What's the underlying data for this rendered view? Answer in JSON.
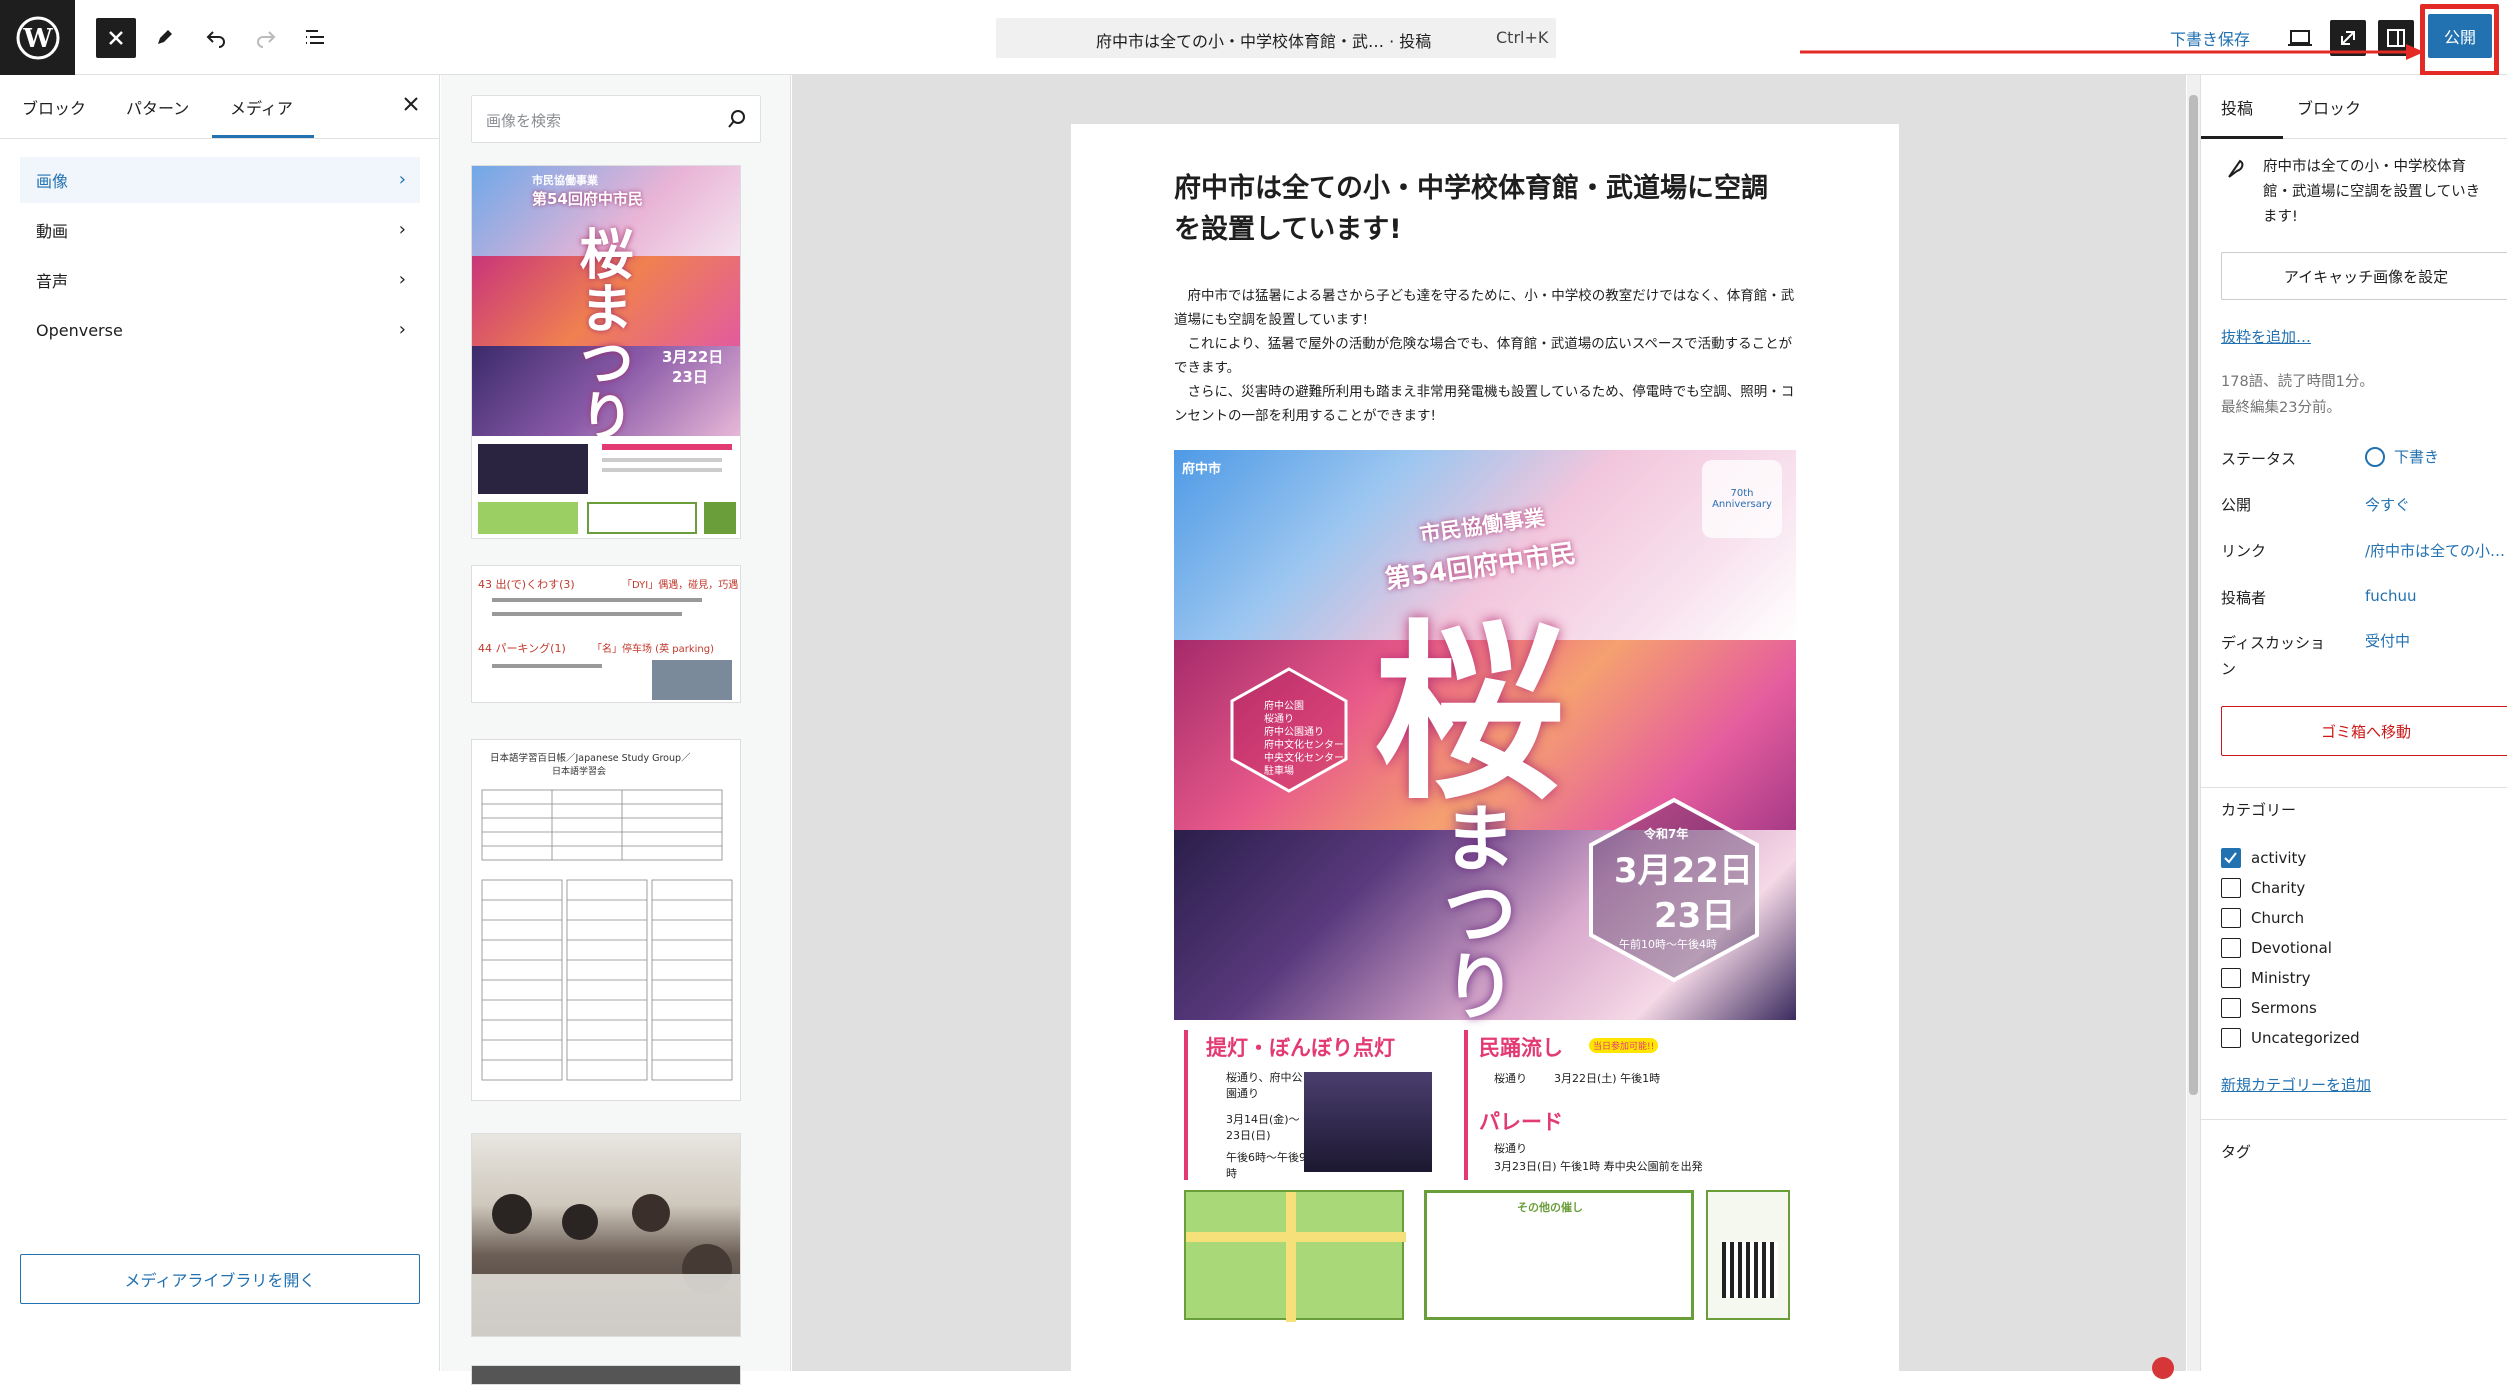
{
  "topbar": {
    "document_title": "府中市は全ての小・中学校体育館・武…  · 投稿",
    "shortcut": "Ctrl+K",
    "save_draft": "下書き保存",
    "publish": "公開"
  },
  "inserter": {
    "tabs": [
      "ブロック",
      "パターン",
      "メディア"
    ],
    "active_tab": "メディア",
    "categories": [
      "画像",
      "動画",
      "音声",
      "Openverse"
    ],
    "selected_category": "画像",
    "open_library": "メディアライブラリを開く"
  },
  "media": {
    "search_placeholder": "画像を検索",
    "poster_thumb": {
      "org": "市民協働事業",
      "event": "第54回府中市民",
      "big": "桜まつり",
      "date1": "3月22日",
      "date2": "23日"
    },
    "map_thumb": {
      "line1": "43 出(で)くわす(3)",
      "line1b": "「DYI」偶遇，碰見，巧遇",
      "line2": "44 パーキング(1)",
      "line2b": "「名」停车场 (英 parking)"
    },
    "schedule_thumb": {
      "title": "日本語学習百日帳／Japanese Study Group／",
      "sub": "日本語学習会"
    }
  },
  "post": {
    "title": "府中市は全ての小・中学校体育館・武道場に空調を設置しています!",
    "paragraphs": [
      "府中市では猛暑による暑さから子ども達を守るために、小・中学校の教室だけではなく、体育館・武道場にも空調を設置しています!",
      "これにより、猛暑で屋外の活動が危険な場合でも、体育館・武道場の広いスペースで活動することができます。",
      "さらに、災害時の避難所利用も踏まえ非常用発電機も設置しているため、停電時でも空調、照明・コンセントの一部を利用することができます!"
    ],
    "poster": {
      "city": "府中市",
      "org": "市民協働事業",
      "event": "第54回府中市民",
      "big1": "桜",
      "big2": "まつり",
      "era": "令和7年",
      "date1": "3月22日",
      "date2": "23日",
      "time": "午前10時〜午後4時",
      "venues": [
        "府中公園",
        "桜通り",
        "府中公園通り",
        "府中文化センター",
        "中央文化センター",
        "駐車場"
      ],
      "ev1_title": "提灯・ぼんぼり点灯",
      "ev1_place": "桜通り、府中公園通り",
      "ev1_date": "3月14日(金)〜23日(日)",
      "ev1_time": "午後6時〜午後9時",
      "ev2_title": "民踊流し",
      "ev2_tag": "当日参加可能!!",
      "ev2_place": "桜通り",
      "ev2_date": "3月22日(土) 午後1時",
      "ev3_title": "パレード",
      "ev3_place": "桜通り",
      "ev3_date": "3月23日(日) 午後1時 寿中央公園前を出発",
      "other": "その他の催し",
      "anniv": "70th Anniversary"
    }
  },
  "sidebar": {
    "tabs": [
      "投稿",
      "ブロック"
    ],
    "post_title": "府中市は全ての小・中学校体育館・武道場に空調を設置していきます!",
    "featured_image": "アイキャッチ画像を設定",
    "add_excerpt": "抜粋を追加…",
    "word_count": "178語、読了時間1分。",
    "last_edited": "最終編集23分前。",
    "rows": [
      {
        "label": "ステータス",
        "value": "下書き"
      },
      {
        "label": "公開",
        "value": "今すぐ"
      },
      {
        "label": "リンク",
        "value": "/府中市は全ての小…"
      },
      {
        "label": "投稿者",
        "value": "fuchuu"
      },
      {
        "label": "ディスカッション",
        "value": "受付中"
      }
    ],
    "trash": "ゴミ箱へ移動",
    "categories_title": "カテゴリー",
    "categories": [
      {
        "name": "activity",
        "checked": true
      },
      {
        "name": "Charity",
        "checked": false
      },
      {
        "name": "Church",
        "checked": false
      },
      {
        "name": "Devotional",
        "checked": false
      },
      {
        "name": "Ministry",
        "checked": false
      },
      {
        "name": "Sermons",
        "checked": false
      },
      {
        "name": "Uncategorized",
        "checked": false
      }
    ],
    "add_category": "新規カテゴリーを追加",
    "tags_title": "タグ"
  },
  "colors": {
    "accent": "#2271b1",
    "highlight": "#e32a25",
    "danger": "#cc1818"
  }
}
